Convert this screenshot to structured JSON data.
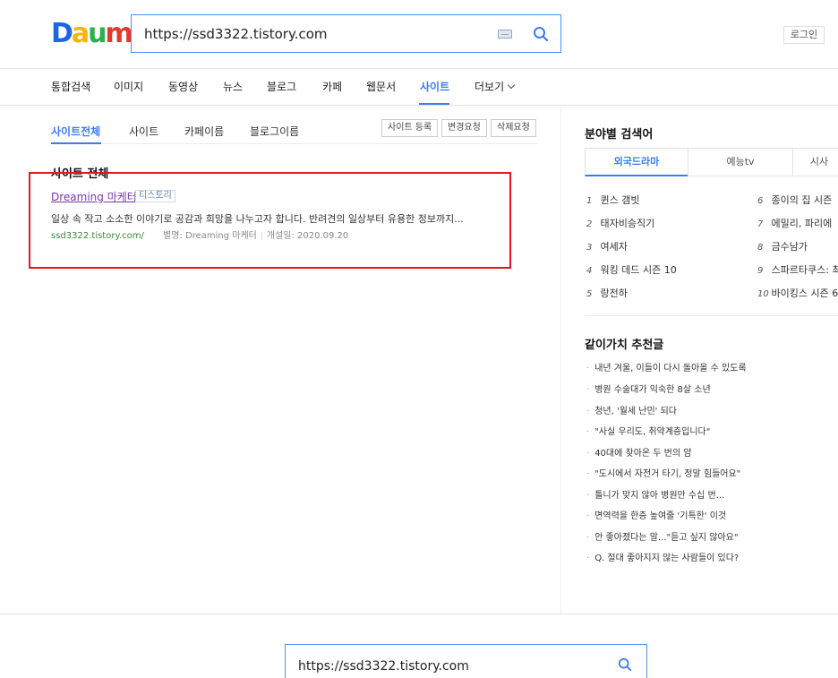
{
  "header": {
    "logo": [
      "D",
      "a",
      "u",
      "m"
    ],
    "logo_colors": [
      "#1b66e4",
      "#f8b400",
      "#28b34a",
      "#e8382c"
    ],
    "search_value": "https://ssd3322.tistory.com",
    "login_label": "로그인"
  },
  "nav": {
    "items": [
      "통합검색",
      "이미지",
      "동영상",
      "뉴스",
      "블로그",
      "카페",
      "웹문서",
      "사이트",
      "더보기"
    ],
    "active": "사이트"
  },
  "subtabs": {
    "items": [
      "사이트전체",
      "사이트",
      "카페이름",
      "블로그이름"
    ],
    "buttons": [
      "사이트 등록",
      "변경요청",
      "삭제요청"
    ]
  },
  "results": {
    "section_title": "사이트 전체",
    "items": [
      {
        "title": "Dreaming 마케터",
        "badge": "티스토리",
        "description": "일상 속 작고 소소한 이야기로 공감과 희망을 나누고자 합니다. 반려견의 일상부터 유용한 정보까지...",
        "url": "ssd3322.tistory.com/",
        "alias": "별명: Dreaming 마케터",
        "opened": "개설일: 2020.09.20"
      }
    ]
  },
  "right": {
    "category_title": "분야별 검색어",
    "category_tabs": [
      "외국드라마",
      "예능tv",
      "시사"
    ],
    "rankings_left": [
      {
        "n": "1",
        "t": "퀸스 갬빗"
      },
      {
        "n": "2",
        "t": "태자비승직기"
      },
      {
        "n": "3",
        "t": "여세자"
      },
      {
        "n": "4",
        "t": "워킹 데드 시즌 10"
      },
      {
        "n": "5",
        "t": "랑전하"
      }
    ],
    "rankings_right": [
      {
        "n": "6",
        "t": "종이의 집 시즌"
      },
      {
        "n": "7",
        "t": "에밀리, 파리에"
      },
      {
        "n": "8",
        "t": "금수남가"
      },
      {
        "n": "9",
        "t": "스파르타쿠스: 최"
      },
      {
        "n": "10",
        "t": "바이킹스 시즌 6"
      }
    ],
    "recommend_title": "같이가치 추천글",
    "recommend": [
      "내년 겨울, 이들이 다시 돌아올 수 있도록",
      "병원 수술대가 익숙한 8살 소년",
      "청년, '월세 난민' 되다",
      "\"사실 우리도, 취약계층입니다\"",
      "40대에 찾아온 두 번의 암",
      "\"도시에서 자전거 타기, 정말 힘들어요\"",
      "틀니가 맞지 않아 병원만 수십 번...",
      "면역력을 한층 높여줄 '기특한' 이것",
      "안 좋아졌다는 말...\"듣고 싶지 않아요\"",
      "Q. 절대 좋아지지 않는 사람들이 있다?"
    ]
  },
  "footer": {
    "search_value": "https://ssd3322.tistory.com"
  }
}
